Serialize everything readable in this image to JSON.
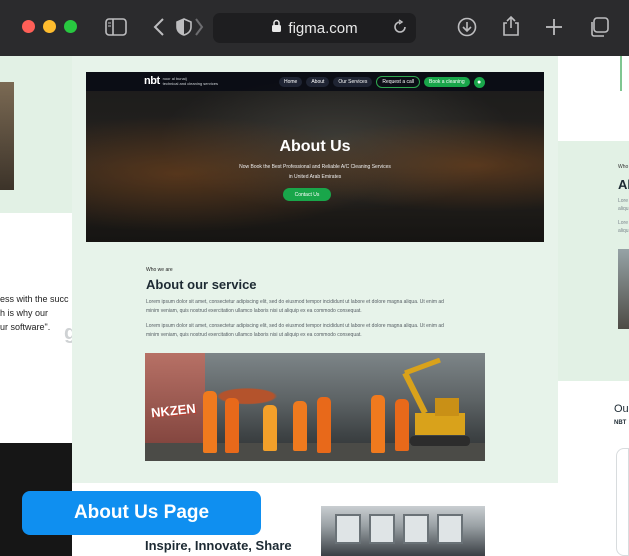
{
  "browser": {
    "url": "figma.com",
    "icons": [
      "sidebar-icon",
      "back-icon",
      "shield-icon",
      "forward-icon",
      "lock-icon",
      "reload-icon",
      "download-icon",
      "share-icon",
      "new-tab-icon",
      "tabs-icon"
    ]
  },
  "left_frame": {
    "text_lines": [
      "ess with the succ",
      "h is why our",
      "ur software\"."
    ],
    "partial_glyph": "g"
  },
  "site": {
    "logo_mark": "nbt",
    "logo_line1": "noor al bunaij",
    "logo_line2": "technical and cleaning services",
    "nav": [
      "Home",
      "About",
      "Our Services",
      "Request a call",
      "Book a cleaning"
    ],
    "hero_title": "About Us",
    "hero_subtitle_1": "Now Book the Best Professional and Reliable A/C Cleaning Services",
    "hero_subtitle_2": "in United Arab Emirates",
    "hero_button": "Contact Us",
    "kicker": "Who we are",
    "section_title": "About our service",
    "para1": "Lorem ipsum dolor sit amet, consectetur adipiscing elit, sed do eiusmod tempor incididunt ut labore et dolore magna aliqua. Ut enim ad minim veniam, quis nostrud exercitation ullamco laboris nisi ut aliquip ex ea commodo consequat.",
    "para2": "Lorem ipsum dolor sit amet, consectetur adipiscing elit, sed do eiusmod tempor incididunt ut labore et dolore magna aliqua. Ut enim ad minim veniam, quis nostrud exercitation ullamco laboris nisi ut aliquip ex ea commodo consequat.",
    "graffiti": "NKZEN",
    "inspire_heading": "Inspire, Innovate, Share"
  },
  "right_frame": {
    "small": "Who",
    "title": "Al",
    "lines": [
      "Lore",
      "aliqu",
      "Lore",
      "aliqu"
    ],
    "heading": "Ou",
    "sub": "NBT"
  },
  "badge": "About Us Page"
}
